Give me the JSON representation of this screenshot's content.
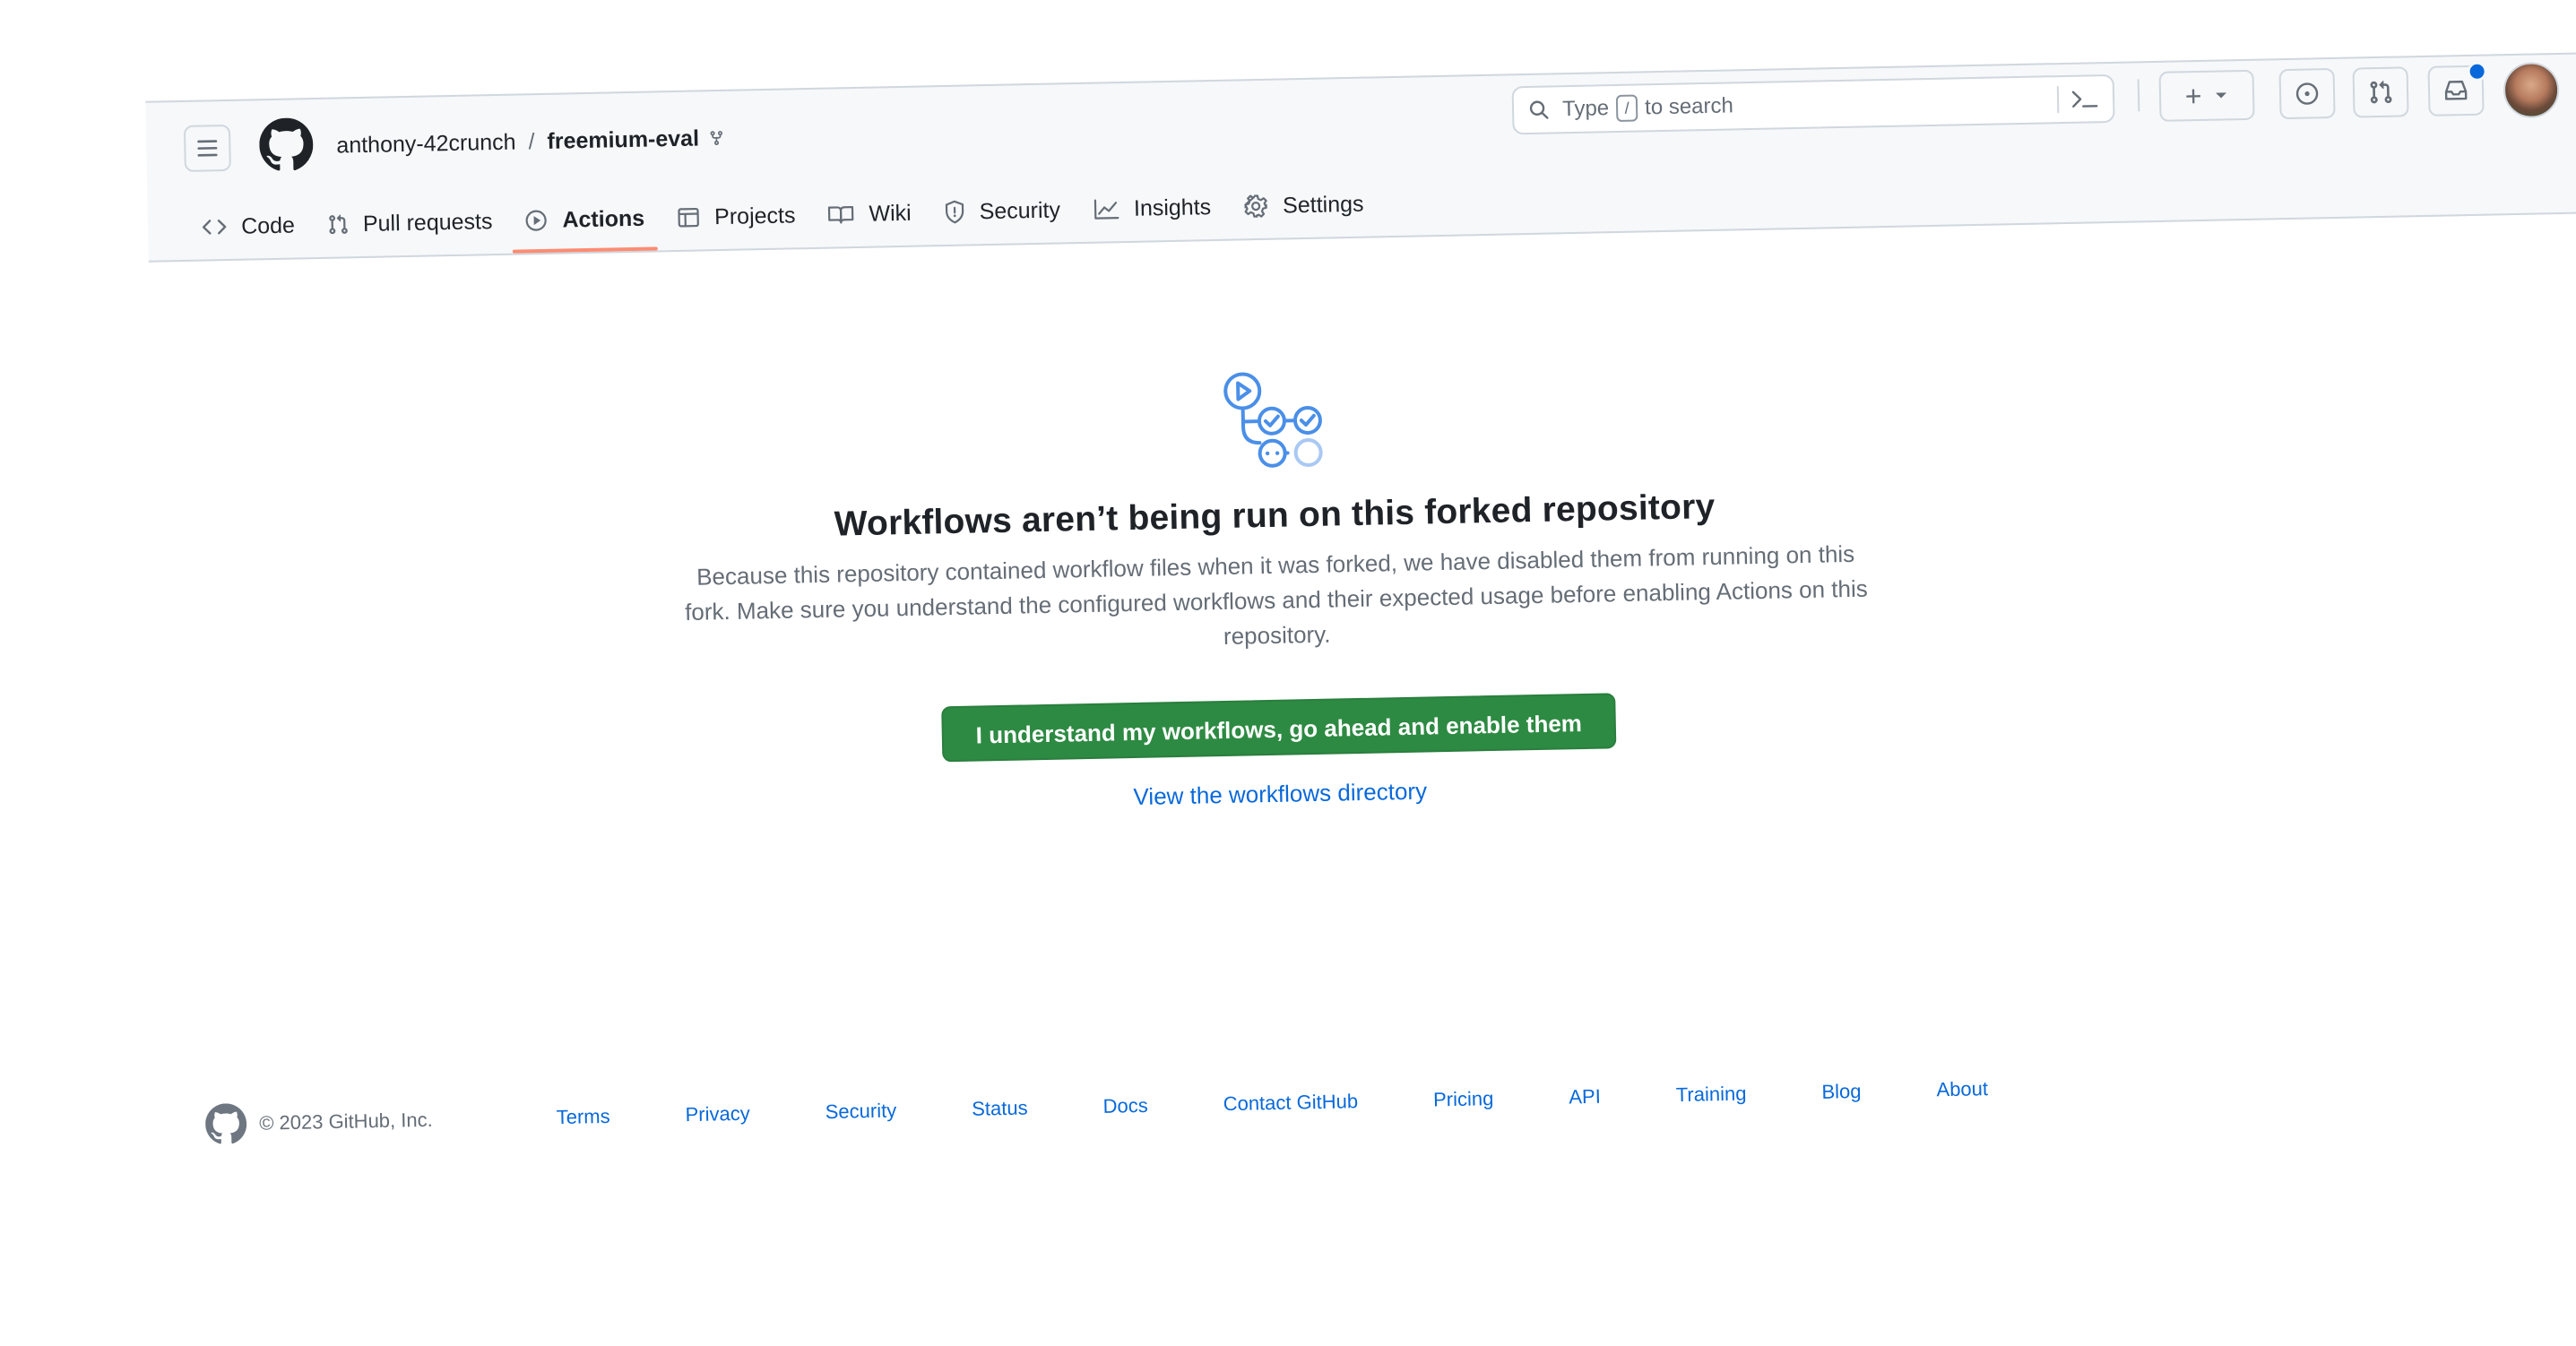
{
  "header": {
    "owner": "anthony-42crunch",
    "separator": "/",
    "repo": "freemium-eval",
    "search": {
      "prefix": "Type",
      "key": "/",
      "suffix": "to search"
    },
    "create_label": "+"
  },
  "tabs": [
    {
      "label": "Code",
      "icon": "code-icon",
      "active": false
    },
    {
      "label": "Pull requests",
      "icon": "git-pull-request-icon",
      "active": false
    },
    {
      "label": "Actions",
      "icon": "play-icon",
      "active": true
    },
    {
      "label": "Projects",
      "icon": "table-icon",
      "active": false
    },
    {
      "label": "Wiki",
      "icon": "book-icon",
      "active": false
    },
    {
      "label": "Security",
      "icon": "shield-icon",
      "active": false
    },
    {
      "label": "Insights",
      "icon": "graph-icon",
      "active": false
    },
    {
      "label": "Settings",
      "icon": "gear-icon",
      "active": false
    }
  ],
  "main": {
    "title": "Workflows aren’t being run on this forked repository",
    "description": "Because this repository contained workflow files when it was forked, we have disabled them from running on this fork. Make sure you understand the configured workflows and their expected usage before enabling Actions on this repository.",
    "enable_button": "I understand my workflows, go ahead and enable them",
    "view_link": "View the workflows directory"
  },
  "footer": {
    "copyright": "© 2023 GitHub, Inc.",
    "links": [
      "Terms",
      "Privacy",
      "Security",
      "Status",
      "Docs",
      "Contact GitHub",
      "Pricing",
      "API",
      "Training",
      "Blog",
      "About"
    ]
  },
  "colors": {
    "primary_button": "#2d8a42",
    "link": "#0969da",
    "active_tab_underline": "#fd8c73",
    "header_bg": "#f6f8fa"
  }
}
